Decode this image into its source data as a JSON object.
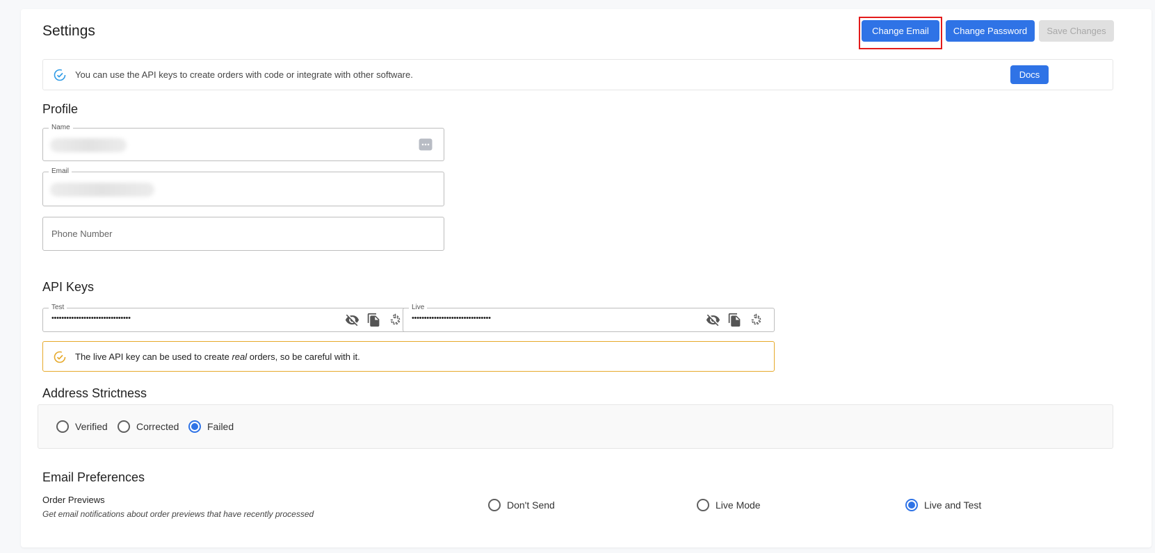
{
  "header": {
    "title": "Settings",
    "change_email": "Change Email",
    "change_password": "Change Password",
    "save_changes": "Save Changes"
  },
  "info": {
    "text": "You can use the API keys to create orders with code or integrate with other software.",
    "docs": "Docs"
  },
  "profile": {
    "title": "Profile",
    "name_label": "Name",
    "email_label": "Email",
    "phone_placeholder": "Phone Number"
  },
  "api_keys": {
    "title": "API Keys",
    "test_label": "Test",
    "test_value": "••••••••••••••••••••••••••••••••",
    "live_label": "Live",
    "live_value": "••••••••••••••••••••••••••••••••",
    "warning_pre": "The live API key can be used to create ",
    "warning_em": "real",
    "warning_post": " orders, so be careful with it."
  },
  "address": {
    "title": "Address Strictness",
    "options": [
      "Verified",
      "Corrected",
      "Failed"
    ],
    "selected": "Failed"
  },
  "email_prefs": {
    "title": "Email Preferences",
    "order_previews_label": "Order Previews",
    "order_previews_desc": "Get email notifications about order previews that have recently processed",
    "options": [
      "Don't Send",
      "Live Mode",
      "Live and Test"
    ],
    "selected": "Live and Test"
  },
  "icons": {
    "info": "check-circle-icon",
    "warning": "check-circle-icon",
    "eye": "eye-off-icon",
    "copy": "copy-icon",
    "refresh": "refresh-icon",
    "autofill": "more-icon"
  },
  "colors": {
    "accent": "#2f73e6",
    "warning": "#e6a92a",
    "highlight": "#e31b1b",
    "disabled": "#e0e0e0"
  }
}
